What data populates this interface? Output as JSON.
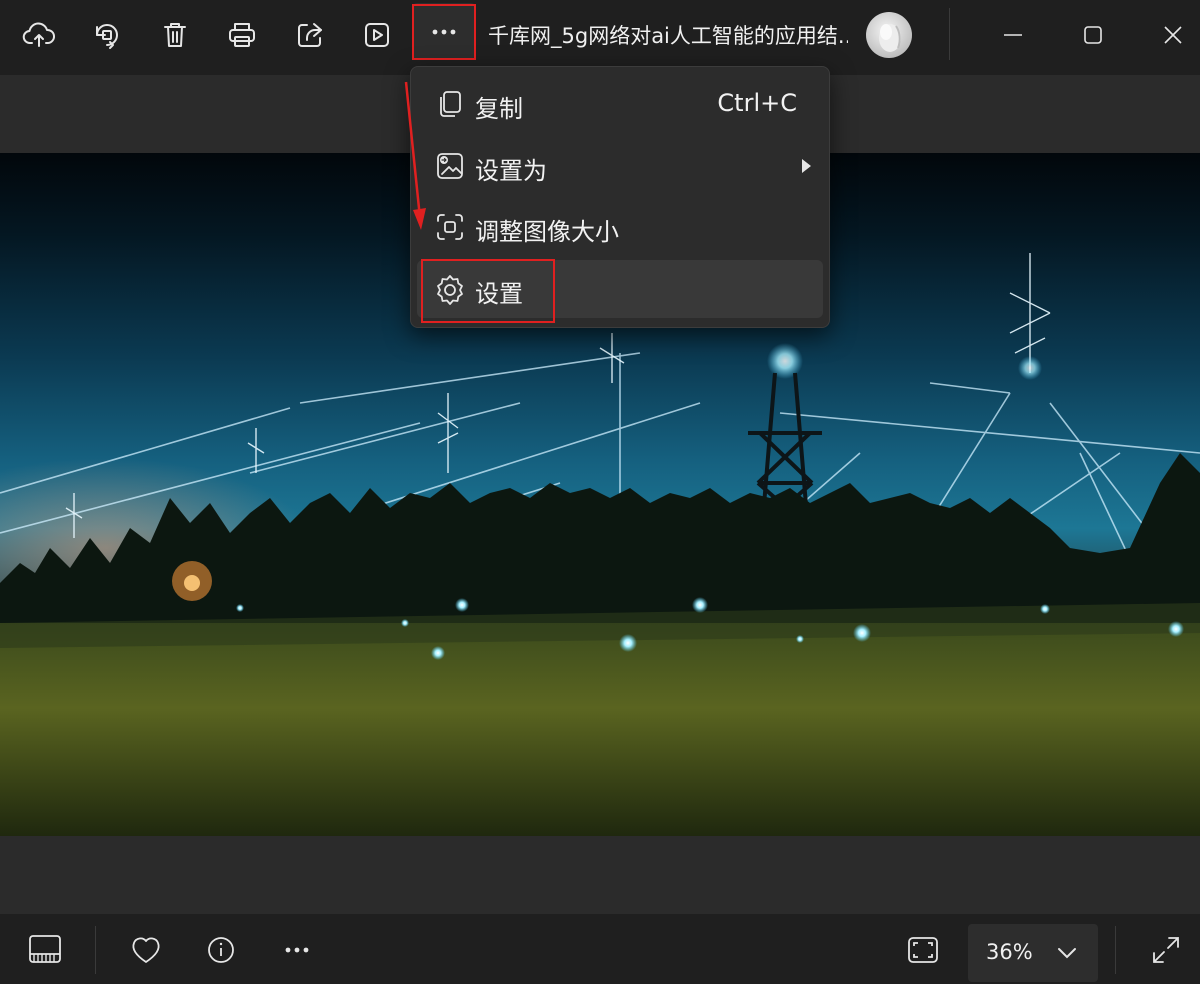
{
  "window": {
    "title": "千库网_5g网络对ai人工智能的应用结..."
  },
  "toolbar": {
    "buttons": [
      "cloud-upload-icon",
      "rotate-icon",
      "delete-icon",
      "print-icon",
      "share-icon",
      "slideshow-icon",
      "more-icon"
    ]
  },
  "menu": {
    "items": [
      {
        "label": "复制",
        "shortcut": "Ctrl+C",
        "icon": "copy-icon"
      },
      {
        "label": "设置为",
        "icon": "set-as-icon",
        "submenu": true
      },
      {
        "label": "调整图像大小",
        "icon": "resize-icon"
      },
      {
        "label": "设置",
        "icon": "gear-icon"
      }
    ]
  },
  "bottombar": {
    "zoom": "36%"
  },
  "colors": {
    "highlight_box": "#e02020",
    "bar_bg": "#1f1f1f",
    "menu_bg": "#2c2c2c"
  }
}
